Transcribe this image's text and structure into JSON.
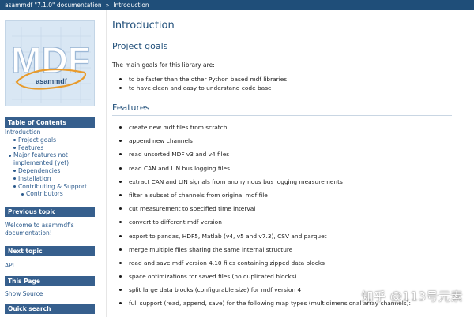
{
  "breadcrumb": {
    "root": "asammdf \"7.1.0\" documentation",
    "separator": "»",
    "current": "Introduction"
  },
  "sidebar": {
    "logo_text": "MDF",
    "logo_subtext": "asammdf",
    "toc_heading": "Table of Contents",
    "toc": [
      {
        "label": "Introduction",
        "level": 1
      },
      {
        "label": "Project goals",
        "level": 2
      },
      {
        "label": "Features",
        "level": 2
      },
      {
        "label": "Major features not implemented (yet)",
        "level": 2
      },
      {
        "label": "Dependencies",
        "level": 2
      },
      {
        "label": "Installation",
        "level": 2
      },
      {
        "label": "Contributing & Support",
        "level": 2
      },
      {
        "label": "Contributors",
        "level": 3
      }
    ],
    "prev_heading": "Previous topic",
    "prev_link": "Welcome to asammdf's documentation!",
    "next_heading": "Next topic",
    "next_link": "API",
    "this_page_heading": "This Page",
    "show_source": "Show Source",
    "quick_search_heading": "Quick search"
  },
  "main": {
    "title": "Introduction",
    "goals_heading": "Project goals",
    "goals_intro": "The main goals for this library are:",
    "goals": [
      "to be faster than the other Python based mdf libraries",
      "to have clean and easy to understand code base"
    ],
    "features_heading": "Features",
    "features": [
      "create new mdf files from scratch",
      "append new channels",
      "read unsorted MDF v3 and v4 files",
      "read CAN and LIN bus logging files",
      "extract CAN and LIN signals from anonymous bus logging measurements",
      "filter a subset of channels from original mdf file",
      "cut measurement to specified time interval",
      "convert to different mdf version",
      "export to pandas, HDF5, Matlab (v4, v5 and v7.3), CSV and parquet",
      "merge multiple files sharing the same internal structure",
      "read and save mdf version 4.10 files containing zipped data blocks",
      "space optimizations for saved files (no duplicated blocks)",
      "split large data blocks (configurable size) for mdf version 4",
      "full support (read, append, save) for the following map types (multidimensional array channels):"
    ]
  },
  "watermark": "知乎 @113号元素",
  "colors": {
    "topbar": "#1f4e79",
    "side_heading": "#365f8d",
    "link": "#2b5a8c",
    "heading": "#1f4e79"
  }
}
